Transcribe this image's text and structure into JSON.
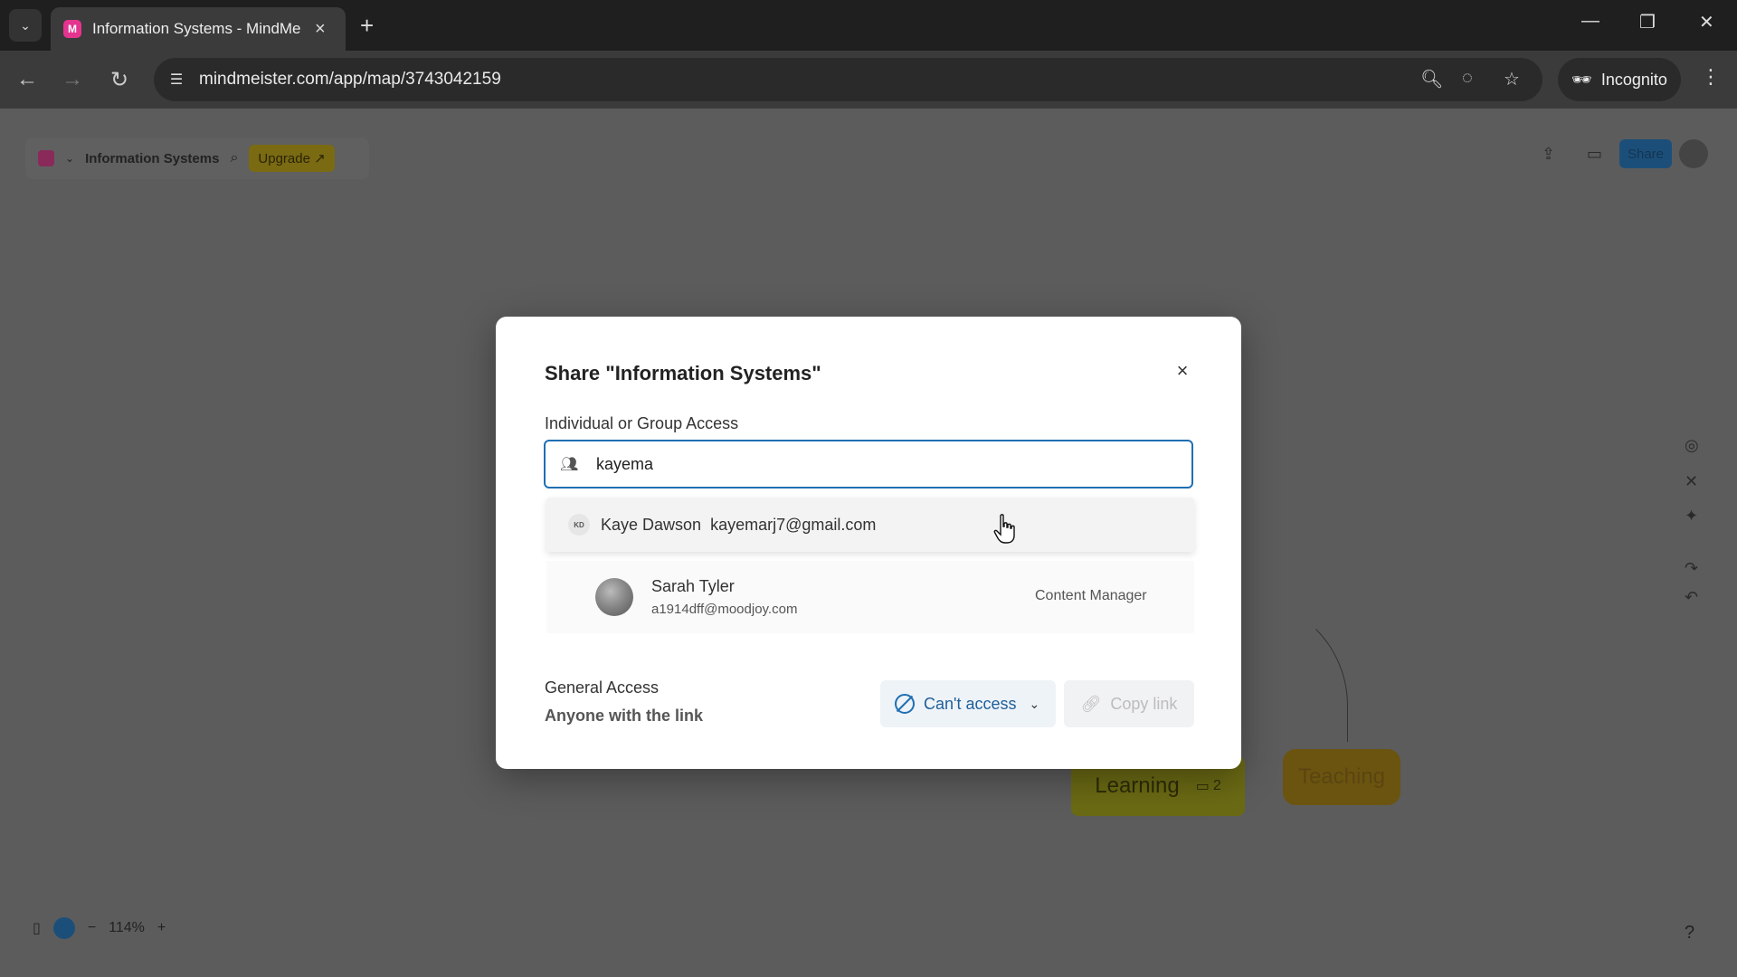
{
  "browser": {
    "tab_title": "Information Systems - MindMe",
    "url": "mindmeister.com/app/map/3743042159",
    "incognito_label": "Incognito",
    "new_tab_symbol": "+",
    "favicon_letter": "M"
  },
  "app": {
    "map_title": "Information Systems",
    "upgrade_label": "Upgrade ↗",
    "share_label": "Share",
    "zoom_level": "114%",
    "nodes": {
      "learning_label": "Learning",
      "learning_count": "2",
      "teaching_label": "Teaching"
    }
  },
  "dialog": {
    "title": "Share \"Information Systems\"",
    "individual_label": "Individual or Group Access",
    "search_value": "kayema",
    "suggestion": {
      "initials": "KD",
      "name": "Kaye Dawson",
      "email": "kayemarj7@gmail.com"
    },
    "member": {
      "name": "Sarah Tyler",
      "email": "a1914dff@moodjoy.com",
      "role": "Content Manager"
    },
    "general_access_label": "General Access",
    "general_access_sub": "Anyone with the link",
    "access_option": "Can't access",
    "copy_link_label": "Copy link"
  },
  "colors": {
    "accent": "#1f6fb2",
    "favicon": "#e5348f",
    "learning_node": "#6b6a14",
    "teaching_node": "#6b5410"
  }
}
